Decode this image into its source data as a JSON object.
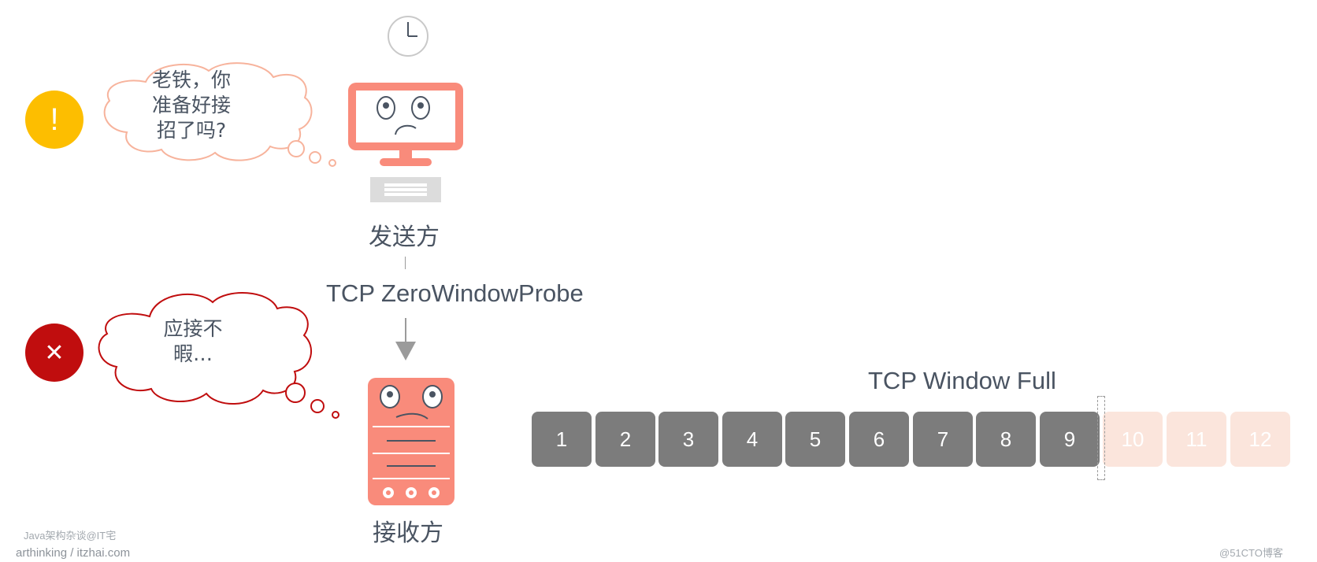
{
  "sender": {
    "label": "发送方",
    "speech_lines": [
      "老铁，你",
      "准备好接",
      "招了吗?"
    ],
    "status_icon": "exclamation-icon",
    "status_text": "!",
    "status_color": "#fdbe00"
  },
  "receiver": {
    "label": "接收方",
    "speech_lines": [
      "应接不",
      "暇…"
    ],
    "status_icon": "x-mark-icon",
    "status_text": "✕",
    "status_color": "#c00d0e"
  },
  "probe": {
    "label": "TCP ZeroWindowProbe"
  },
  "window": {
    "title": "TCP Window Full",
    "segments": [
      {
        "num": "1",
        "state": "sent"
      },
      {
        "num": "2",
        "state": "sent"
      },
      {
        "num": "3",
        "state": "sent"
      },
      {
        "num": "4",
        "state": "sent"
      },
      {
        "num": "5",
        "state": "sent"
      },
      {
        "num": "6",
        "state": "sent"
      },
      {
        "num": "7",
        "state": "sent"
      },
      {
        "num": "8",
        "state": "sent"
      },
      {
        "num": "9",
        "state": "sent"
      },
      {
        "num": "10",
        "state": "pending"
      },
      {
        "num": "11",
        "state": "pending"
      },
      {
        "num": "12",
        "state": "pending"
      }
    ]
  },
  "colors": {
    "accent": "#f98b7b",
    "sent_segment": "#7c7c7c",
    "pending_segment": "#fbe5dc"
  },
  "footer": {
    "line1": "Java架构杂谈@IT宅",
    "line2": "arthinking / itzhai.com",
    "watermark": "@51CTO博客"
  }
}
